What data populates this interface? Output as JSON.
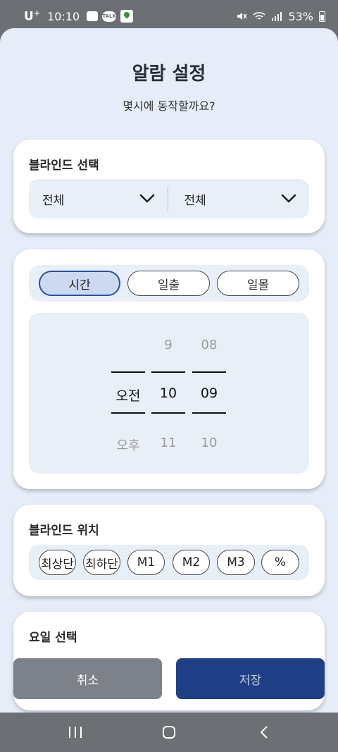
{
  "status_bar": {
    "carrier": "U",
    "carrier_sup": "+",
    "time": "10:10",
    "battery": "53%",
    "icons": [
      "gallery-icon",
      "talk-icon",
      "map-icon",
      "mute-icon",
      "wifi-icon",
      "signal-icon",
      "battery-icon"
    ],
    "talk_text": "TALK"
  },
  "header": {
    "title": "알람 설정",
    "subtitle": "몇시에 동작할까요?"
  },
  "blind_select": {
    "title": "블라인드 선택",
    "left_value": "전체",
    "right_value": "전체"
  },
  "time_mode": {
    "options": [
      "시간",
      "일출",
      "일몰"
    ],
    "selected": "시간"
  },
  "time_picker": {
    "ampm": {
      "above": "",
      "selected": "오전",
      "below": "오후"
    },
    "hour": {
      "above": "9",
      "selected": "10",
      "below": "11"
    },
    "minute": {
      "above": "08",
      "selected": "09",
      "below": "10"
    }
  },
  "blind_position": {
    "title": "블라인드 위치",
    "options": [
      "최상단",
      "최하단",
      "M1",
      "M2",
      "M3",
      "%"
    ]
  },
  "day_select": {
    "title": "요일 선택"
  },
  "buttons": {
    "cancel": "취소",
    "save": "저장"
  },
  "colors": {
    "accent": "#1f3f87",
    "sheet_bg": "#e6edf8",
    "selected_pill": "#cdd9f0"
  }
}
